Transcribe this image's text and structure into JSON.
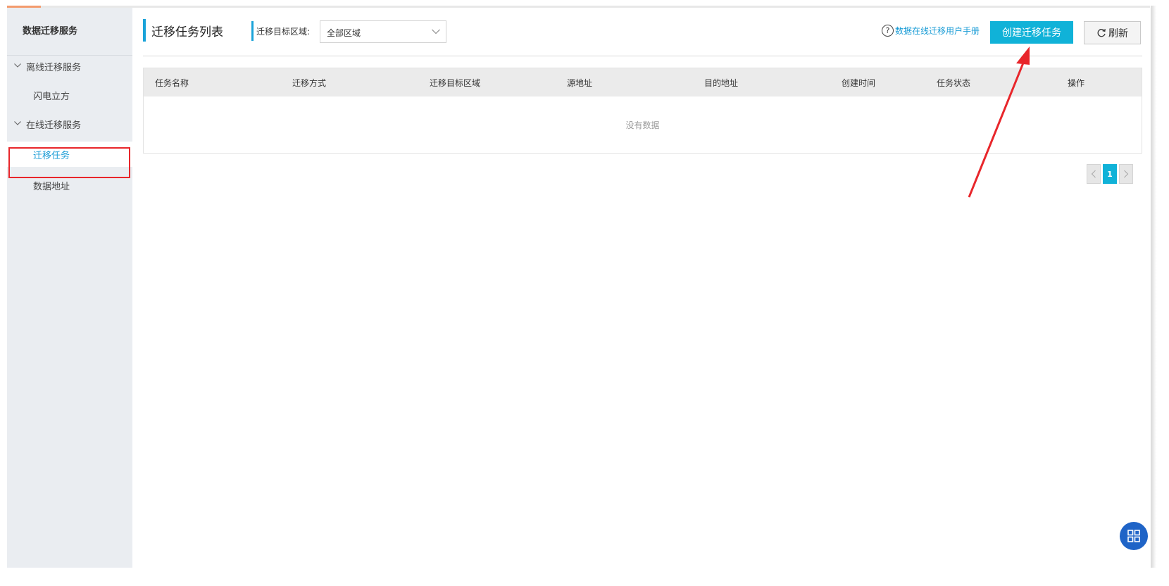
{
  "sidebar": {
    "title": "数据迁移服务",
    "groups": [
      {
        "label": "离线迁移服务",
        "items": [
          {
            "label": "闪电立方"
          }
        ]
      },
      {
        "label": "在线迁移服务",
        "items": [
          {
            "label": "迁移任务",
            "active": true
          },
          {
            "label": "数据地址"
          }
        ]
      }
    ]
  },
  "main": {
    "title": "迁移任务列表",
    "filter": {
      "label": "迁移目标区域:",
      "value": "全部区域"
    },
    "help_link": "数据在线迁移用户手册",
    "create_button": "创建迁移任务",
    "refresh_button": "刷新"
  },
  "table": {
    "columns": [
      "任务名称",
      "迁移方式",
      "迁移目标区域",
      "源地址",
      "目的地址",
      "创建时间",
      "任务状态",
      "操作"
    ],
    "rows": [],
    "empty_text": "没有数据"
  },
  "pagination": {
    "current_page": "1"
  },
  "colors": {
    "accent": "#10b2d8",
    "annotation": "#e8262b",
    "sidebar_bg": "#eaedf1"
  },
  "icons": [
    "chevron-down-icon",
    "help-circle-icon",
    "refresh-icon",
    "chevron-left-icon",
    "chevron-right-icon",
    "grid-apps-icon"
  ]
}
